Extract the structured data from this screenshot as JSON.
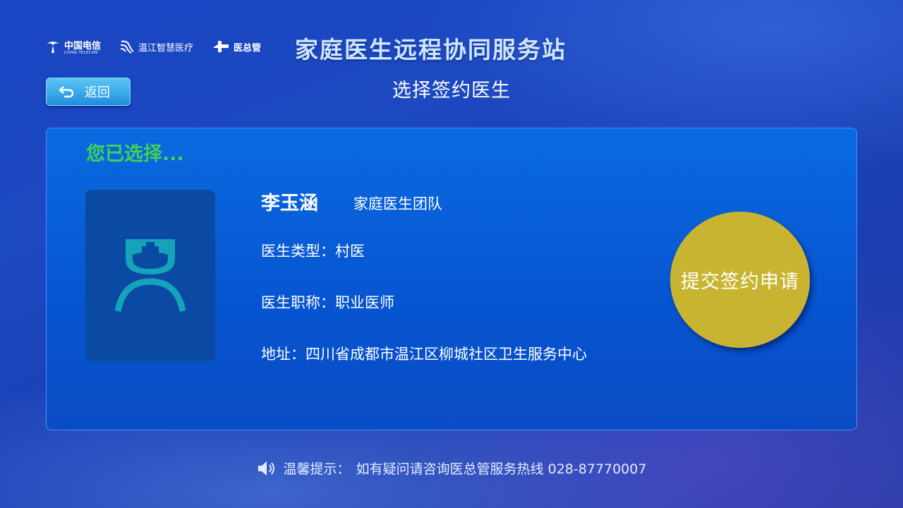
{
  "header": {
    "logos": {
      "telecom_name": "中国电信",
      "telecom_sub": "CHINA TELECOM",
      "wenjiang": "温江智慧医疗",
      "yizongguan": "医总管"
    },
    "site_title": "家庭医生远程协同服务站"
  },
  "nav": {
    "back_label": "返回",
    "page_title": "选择签约医生"
  },
  "panel": {
    "selected_hint": "您已选择...",
    "doctor": {
      "name": "李玉涵",
      "team": "家庭医生团队",
      "type_label": "医生类型：",
      "type_value": "村医",
      "title_label": "医生职称：",
      "title_value": "职业医师",
      "address_label": "地址：",
      "address_value": "四川省成都市温江区柳城社区卫生服务中心"
    },
    "submit_label": "提交签约申请"
  },
  "footer": {
    "tip_label": "温馨提示：",
    "tip_text": "如有疑问请咨询医总管服务热线 028-87770007"
  },
  "colors": {
    "accent_green": "#3fd158",
    "submit_gold": "#c9b431",
    "panel_blue": "#0754d0",
    "avatar_teal": "#14a3b8"
  },
  "icons": [
    "telecom-logo-icon",
    "wenjiang-logo-icon",
    "yizongguan-logo-icon",
    "back-arrow-icon",
    "doctor-avatar-icon",
    "speaker-icon"
  ]
}
